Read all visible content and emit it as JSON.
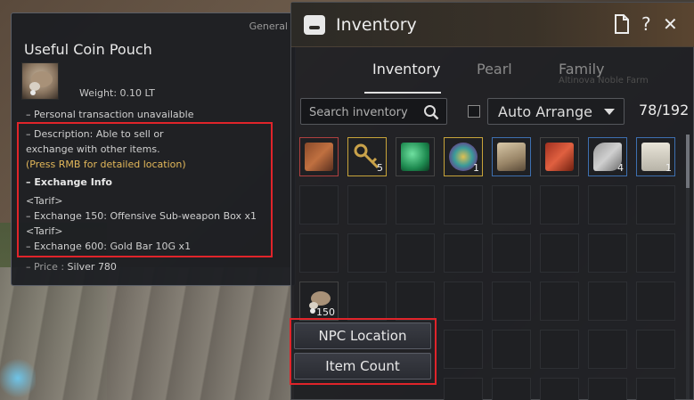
{
  "tooltip": {
    "category": "General",
    "title": "Useful Coin Pouch",
    "weight": "Weight:  0.10 LT",
    "transaction": "– Personal transaction unavailable",
    "desc1": "– Description: Able to sell or",
    "desc2": "exchange with other items.",
    "desc3": "(Press RMB for detailed location)",
    "exchange_head": "– Exchange Info",
    "tarif1": "<Tarif>",
    "exchange1": "– Exchange 150: Offensive Sub-weapon Box x1",
    "tarif2": "<Tarif>",
    "exchange2": "– Exchange 600: Gold Bar 10G x1",
    "price_label": "– Price :",
    "price_value": "Silver 780"
  },
  "inventory": {
    "title": "Inventory",
    "tabs": [
      "Inventory",
      "Pearl",
      "Family"
    ],
    "active_tab": "Inventory",
    "search_placeholder": "Search inventory",
    "auto_arrange": "Auto Arrange",
    "count": "78/192",
    "faint_text": "Altinova Noble Farm",
    "items": [
      {
        "name": "bag-item-icon",
        "qty": "",
        "grade": "red"
      },
      {
        "name": "key-item-icon",
        "qty": "5",
        "grade": "yellow"
      },
      {
        "name": "green-gem-item-icon",
        "qty": "",
        "grade": "none"
      },
      {
        "name": "rune-item-icon",
        "qty": "1",
        "grade": "yellow"
      },
      {
        "name": "scroll-item-icon",
        "qty": "",
        "grade": "blue"
      },
      {
        "name": "plus-ten-item-icon",
        "qty": "",
        "grade": "none"
      },
      {
        "name": "feather-item-icon",
        "qty": "4",
        "grade": "blue"
      },
      {
        "name": "note-item-icon",
        "qty": "1",
        "grade": "blue"
      }
    ],
    "coin_pouch_qty": "150"
  },
  "context_menu": {
    "npc_location": "NPC Location",
    "item_count": "Item Count"
  },
  "colors": {
    "highlight_box": "#e0242a",
    "gold_text": "#e3b85a"
  }
}
